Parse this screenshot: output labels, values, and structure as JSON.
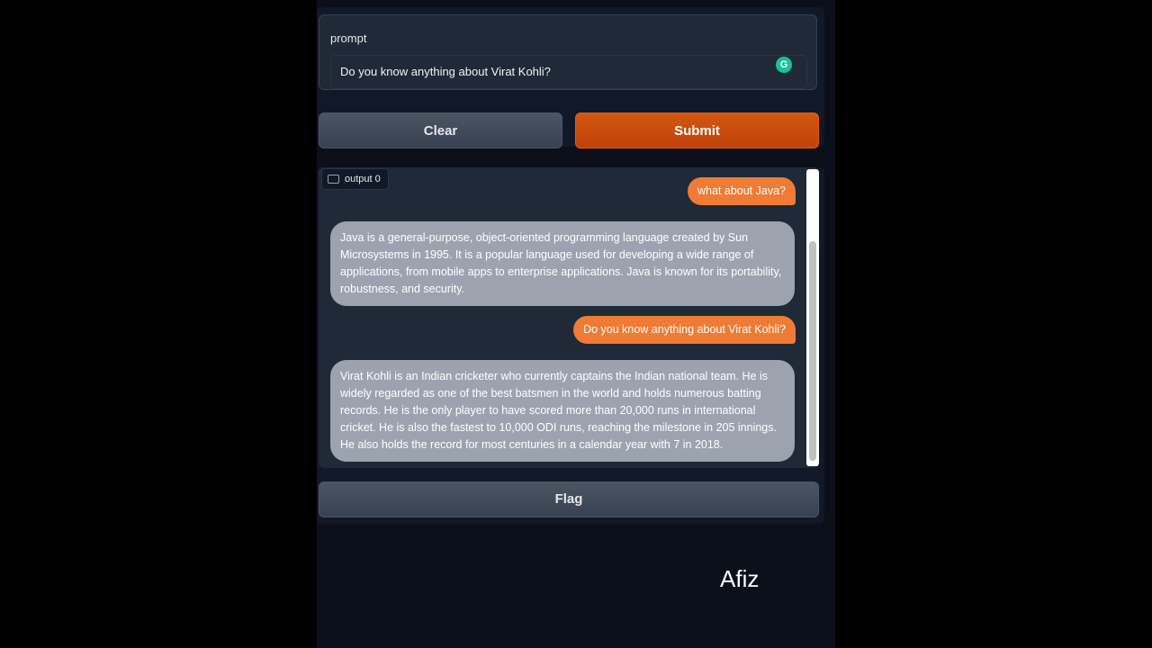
{
  "prompt": {
    "label": "prompt",
    "value": "Do you know anything about Virat Kohli?"
  },
  "buttons": {
    "clear": "Clear",
    "submit": "Submit",
    "flag": "Flag"
  },
  "output": {
    "tag_label": "output 0",
    "messages": [
      {
        "role": "user",
        "text": "what about Java?"
      },
      {
        "role": "bot",
        "text": "Java is a general-purpose, object-oriented programming language created by Sun Microsystems in 1995. It is a popular language used for developing a wide range of applications, from mobile apps to enterprise applications. Java is known for its portability, robustness, and security."
      },
      {
        "role": "user",
        "text": "Do you know anything about Virat Kohli?"
      },
      {
        "role": "bot",
        "text": "Virat Kohli is an Indian cricketer who currently captains the Indian national team. He is widely regarded as one of the best batsmen in the world and holds numerous batting records. He is the only player to have scored more than 20,000 runs in international cricket. He is also the fastest to 10,000 ODI runs, reaching the milestone in 205 innings. He also holds the record for most centuries in a calendar year with 7 in 2018."
      }
    ]
  },
  "watermark": "Afiz",
  "icons": {
    "grammarly": "grammarly-icon",
    "chat": "chat-icon"
  },
  "colors": {
    "user_bubble": "#ef7b35",
    "bot_bubble": "#9ca3af",
    "submit": "#c2410c"
  }
}
